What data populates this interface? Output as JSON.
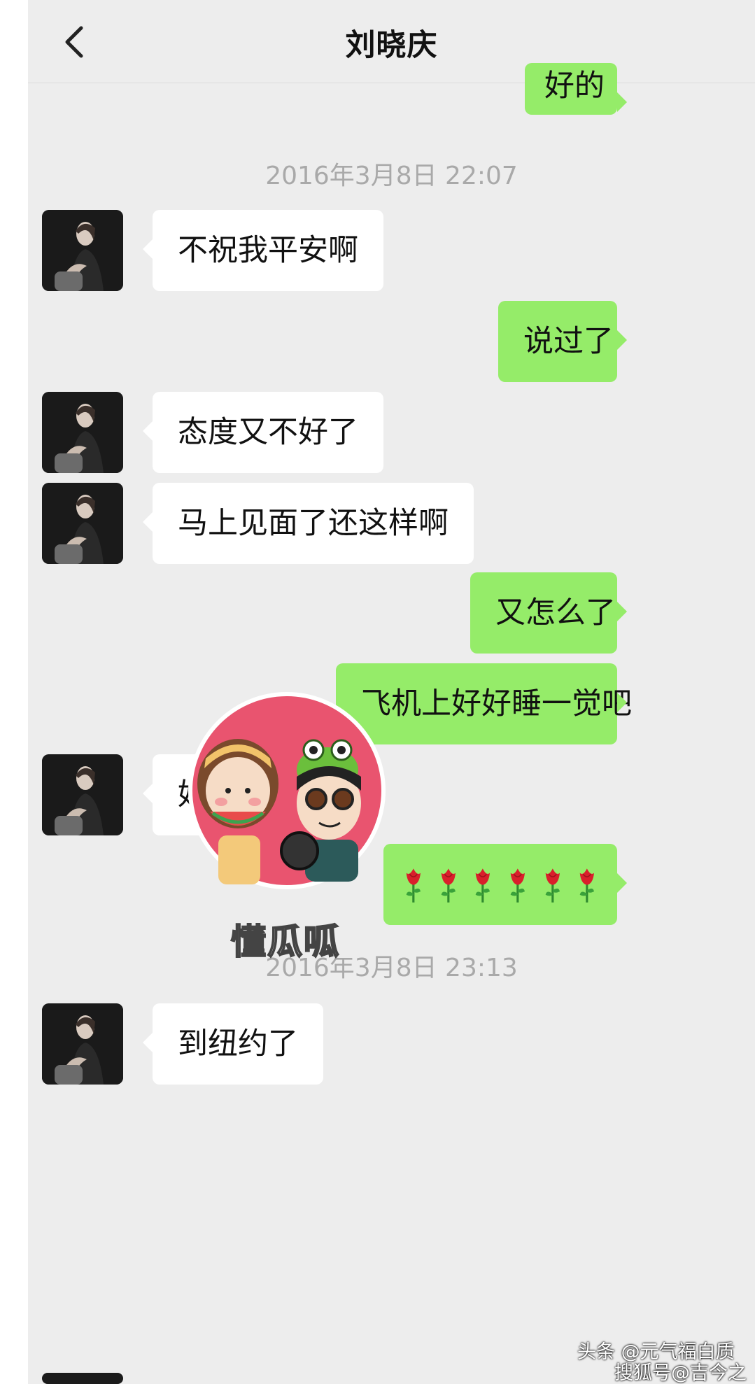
{
  "header": {
    "title": "刘晓庆",
    "back_icon": "chevron-left-icon"
  },
  "messages": [
    {
      "type": "out",
      "text": "好的"
    },
    {
      "type": "timestamp",
      "text": "2016年3月8日 22:07"
    },
    {
      "type": "in",
      "text": "不祝我平安啊"
    },
    {
      "type": "out",
      "text": "说过了"
    },
    {
      "type": "in",
      "text": "态度又不好了"
    },
    {
      "type": "in",
      "text": "马上见面了还这样啊"
    },
    {
      "type": "out",
      "text": "又怎么了"
    },
    {
      "type": "out",
      "text": "飞机上好好睡一觉吧"
    },
    {
      "type": "in",
      "text": "好吧"
    },
    {
      "type": "out",
      "text": "🌹🌹🌹🌹🌹🌹",
      "icon": "rose-icon",
      "count": 6
    },
    {
      "type": "timestamp",
      "text": "2016年3月8日 23:13"
    },
    {
      "type": "in",
      "text": "到纽约了"
    }
  ],
  "watermark": {
    "text": "懂瓜呱"
  },
  "source": {
    "line1": "头条 @元气福白质",
    "line2": "搜狐号@吉今之鉴"
  },
  "colors": {
    "outgoing_bubble": "#95ec69",
    "incoming_bubble": "#ffffff",
    "background": "#ededed"
  }
}
